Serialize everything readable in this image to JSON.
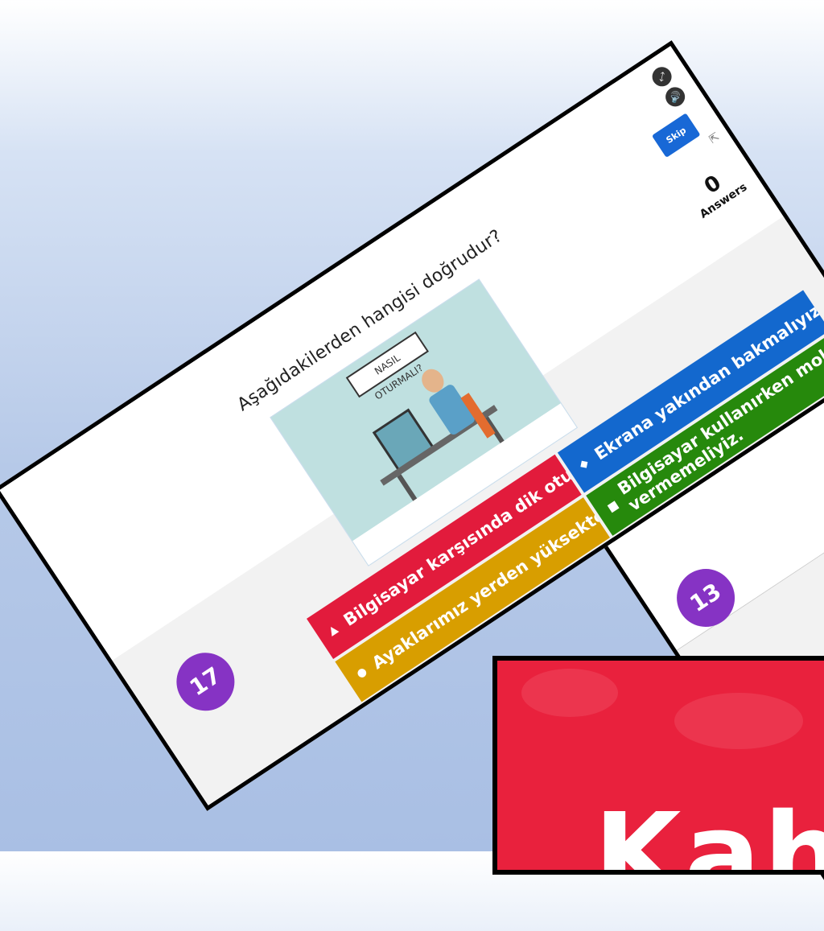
{
  "question": "Aşağıdakilerden hangisi doğrudur?",
  "skip_label": "Skip",
  "answers_count": "0",
  "answers_label": "Answers",
  "timer_main": "17",
  "timer_back": "13",
  "illustration_title": "NASIL OTURMALI?",
  "options": [
    {
      "shape": "▲",
      "label": "Bilgisayar karşısında dik oturmalıyız.",
      "color": "#e21b3c"
    },
    {
      "shape": "◆",
      "label": "Ekrana yakından bakmalıyız.",
      "color": "#1368ce"
    },
    {
      "shape": "●",
      "label": "Ayaklarımız yerden yüksekte olmalı.",
      "color": "#d89e00"
    },
    {
      "shape": "■",
      "label": "Bilgisayar kullanırken mola vermemeliyiz.",
      "color": "#26890c"
    }
  ],
  "icons": {
    "fullscreen": "fullscreen-icon",
    "sound": "sound-icon",
    "cursor": "cursor-icon"
  },
  "logo_text": "Kah"
}
